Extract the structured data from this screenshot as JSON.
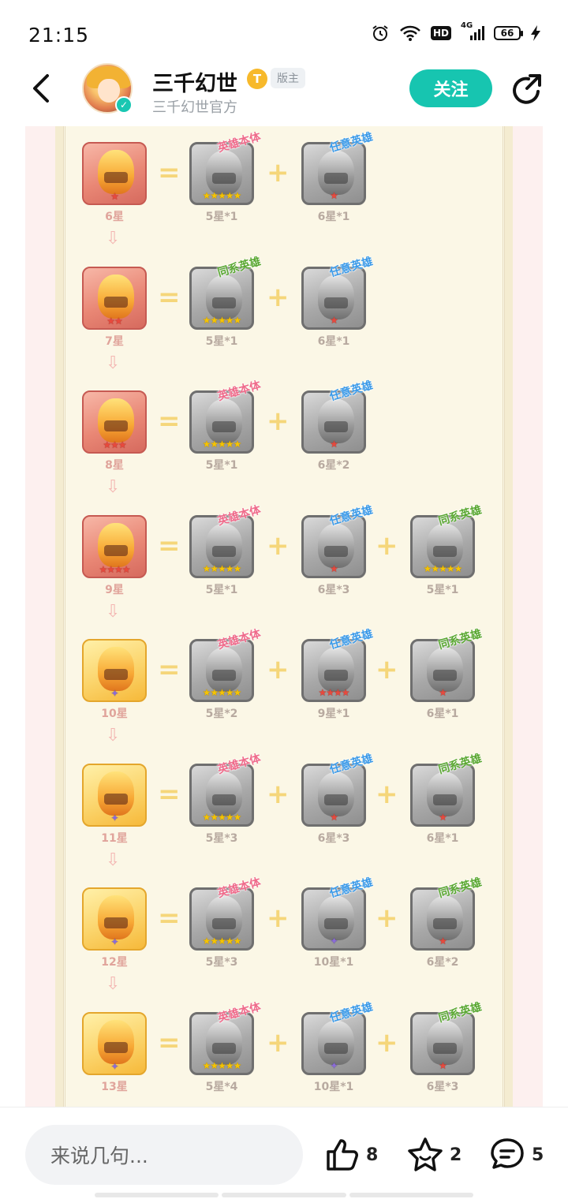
{
  "status_bar": {
    "time": "21:15",
    "network": "4G",
    "hd": "HD",
    "battery": "66"
  },
  "header": {
    "user_name": "三千幻世",
    "level_badge": "T",
    "owner_badge": "版主",
    "subtitle": "三千幻世官方",
    "follow_label": "关注"
  },
  "tags": {
    "hero_body": "英雄本体",
    "any_hero": "任意英雄",
    "same_faction": "同系英雄"
  },
  "rows": [
    {
      "target": "6星",
      "target_style": "red",
      "target_stars": "★",
      "parts": [
        {
          "tag": "hero_body",
          "caption": "5星*1",
          "stars": "★★★★★",
          "star_color": "yellow"
        },
        {
          "tag": "any_hero",
          "caption": "6星*1",
          "stars": "★",
          "star_color": "red"
        }
      ]
    },
    {
      "target": "7星",
      "target_style": "red",
      "target_stars": "★★",
      "parts": [
        {
          "tag": "same_faction",
          "caption": "5星*1",
          "stars": "★★★★★",
          "star_color": "yellow"
        },
        {
          "tag": "any_hero",
          "caption": "6星*1",
          "stars": "★",
          "star_color": "red"
        }
      ]
    },
    {
      "target": "8星",
      "target_style": "red",
      "target_stars": "★★★",
      "parts": [
        {
          "tag": "hero_body",
          "caption": "5星*1",
          "stars": "★★★★★",
          "star_color": "yellow"
        },
        {
          "tag": "any_hero",
          "caption": "6星*2",
          "stars": "★",
          "star_color": "red"
        }
      ]
    },
    {
      "target": "9星",
      "target_style": "red",
      "target_stars": "★★★★",
      "parts": [
        {
          "tag": "hero_body",
          "caption": "5星*1",
          "stars": "★★★★★",
          "star_color": "yellow"
        },
        {
          "tag": "any_hero",
          "caption": "6星*3",
          "stars": "★",
          "star_color": "red"
        },
        {
          "tag": "same_faction",
          "caption": "5星*1",
          "stars": "★★★★★",
          "star_color": "yellow"
        }
      ]
    },
    {
      "target": "10星",
      "target_style": "gold",
      "target_stars": "✦",
      "parts": [
        {
          "tag": "hero_body",
          "caption": "5星*2",
          "stars": "★★★★★",
          "star_color": "yellow"
        },
        {
          "tag": "any_hero",
          "caption": "9星*1",
          "stars": "★★★★",
          "star_color": "red"
        },
        {
          "tag": "same_faction",
          "caption": "6星*1",
          "stars": "★",
          "star_color": "red"
        }
      ]
    },
    {
      "target": "11星",
      "target_style": "gold",
      "target_stars": "✦",
      "parts": [
        {
          "tag": "hero_body",
          "caption": "5星*3",
          "stars": "★★★★★",
          "star_color": "yellow"
        },
        {
          "tag": "any_hero",
          "caption": "6星*3",
          "stars": "★",
          "star_color": "red"
        },
        {
          "tag": "same_faction",
          "caption": "6星*1",
          "stars": "★",
          "star_color": "red"
        }
      ]
    },
    {
      "target": "12星",
      "target_style": "gold",
      "target_stars": "✦",
      "parts": [
        {
          "tag": "hero_body",
          "caption": "5星*3",
          "stars": "★★★★★",
          "star_color": "yellow"
        },
        {
          "tag": "any_hero",
          "caption": "10星*1",
          "stars": "✦",
          "star_color": "purple"
        },
        {
          "tag": "same_faction",
          "caption": "6星*2",
          "stars": "★",
          "star_color": "red"
        }
      ]
    },
    {
      "target": "13星",
      "target_style": "gold",
      "target_stars": "✦",
      "parts": [
        {
          "tag": "hero_body",
          "caption": "5星*4",
          "stars": "★★★★★",
          "star_color": "yellow"
        },
        {
          "tag": "any_hero",
          "caption": "10星*1",
          "stars": "✦",
          "star_color": "purple"
        },
        {
          "tag": "same_faction",
          "caption": "6星*3",
          "stars": "★",
          "star_color": "red"
        }
      ]
    }
  ],
  "symbols": {
    "equals": "=",
    "plus": "+",
    "arrow": "⇩"
  },
  "bottom_bar": {
    "comment_placeholder": "来说几句...",
    "likes": "8",
    "favorites": "2",
    "comments": "5"
  },
  "icons": {
    "back": "chevron-left-icon",
    "share": "share-icon",
    "like": "thumbs-up-icon",
    "favorite": "star-icon",
    "comment": "comment-icon"
  },
  "colors": {
    "accent": "#17c5b0",
    "parchment": "#fbf7e6"
  }
}
